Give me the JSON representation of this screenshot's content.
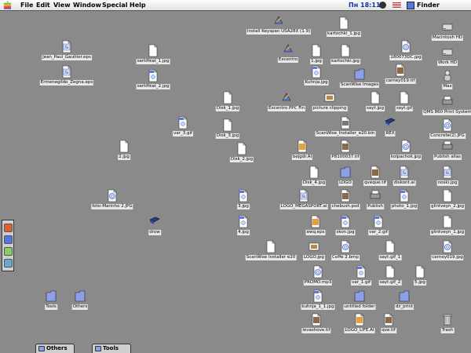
{
  "menubar": {
    "menus": [
      "File",
      "Edit",
      "View",
      "Window",
      "Special",
      "Help"
    ],
    "clock": "Пн 18:11",
    "active_app": "Finder"
  },
  "colors": {
    "desktop": "#8a8a8a",
    "folder": "#8e9fe6",
    "doc": "#ffffff",
    "app": "#5577dd"
  },
  "desktop_icons": [
    {
      "label": "Install Keyspan USA28X (1.9)",
      "type": "app"
    },
    {
      "label": "kartochki_1.jpg",
      "type": "doc"
    },
    {
      "label": "Macintosh HD",
      "type": "disk"
    },
    {
      "label": "Jean_Paul_Gaultier.eps",
      "type": "eps"
    },
    {
      "label": "sertifikat_1.jpg",
      "type": "doc"
    },
    {
      "label": "Excentro",
      "type": "app"
    },
    {
      "label": "1.jpg",
      "type": "doc"
    },
    {
      "label": "kartochki.jpg",
      "type": "doc"
    },
    {
      "label": "180073DC.jpg",
      "type": "qt"
    },
    {
      "label": "Work HD",
      "type": "disk"
    },
    {
      "label": "Ermenegildo_Zegna.eps",
      "type": "eps"
    },
    {
      "label": "sertifikat_2.jpg",
      "type": "jpeg"
    },
    {
      "label": "Kuhnja.jpg",
      "type": "jpeg"
    },
    {
      "label": "ScanWise Images",
      "type": "folder"
    },
    {
      "label": "carney019.tif",
      "type": "photo"
    },
    {
      "label": "Max",
      "type": "user"
    },
    {
      "label": "Disk_1.jpg",
      "type": "doc"
    },
    {
      "label": "Excentro PPC Fin",
      "type": "app"
    },
    {
      "label": "picture clipping",
      "type": "clip"
    },
    {
      "label": "sayt.jpg",
      "type": "doc"
    },
    {
      "label": "sayt.gif",
      "type": "doc"
    },
    {
      "label": "QMS 860 Print System",
      "type": "printer"
    },
    {
      "label": "var_3.gif",
      "type": "gif"
    },
    {
      "label": "Disk_3.jpg",
      "type": "doc"
    },
    {
      "label": "ScanWise_Installer_e20.bin",
      "type": "bin"
    },
    {
      "label": "REX",
      "type": "book"
    },
    {
      "label": "Concrete(2).JPG",
      "type": "qt"
    },
    {
      "label": "2.jpg",
      "type": "doc"
    },
    {
      "label": "Disk_2.jpg",
      "type": "doc"
    },
    {
      "label": "bejgdr.AI",
      "type": "ai"
    },
    {
      "label": "P8100037.tif",
      "type": "photo"
    },
    {
      "label": "kolpachok.jpg",
      "type": "qt"
    },
    {
      "label": "Publish alias",
      "type": "printer"
    },
    {
      "label": "Disk_4.jpg",
      "type": "doc"
    },
    {
      "label": "LOGO",
      "type": "folder"
    },
    {
      "label": "qveque.tif",
      "type": "photo"
    },
    {
      "label": "diskont.ai",
      "type": "eps"
    },
    {
      "label": "noski.jpg",
      "type": "eps"
    },
    {
      "label": "foto-Marinho 2.JPG",
      "type": "qt"
    },
    {
      "label": "3.jpg",
      "type": "jpeg"
    },
    {
      "label": "LOGO_MEGASPORT.ai",
      "type": "eps"
    },
    {
      "label": "chebush.psd",
      "type": "photo"
    },
    {
      "label": "Publish",
      "type": "printer"
    },
    {
      "label": "photo_1.jpg",
      "type": "jpeg"
    },
    {
      "label": "glintveyn_2.jpg",
      "type": "doc"
    },
    {
      "label": "drow",
      "type": "book"
    },
    {
      "label": "4.jpg",
      "type": "jpeg"
    },
    {
      "label": "ewq.eps",
      "type": "ai"
    },
    {
      "label": "skon.jpg",
      "type": "jpeg"
    },
    {
      "label": "var_2.gif",
      "type": "gif"
    },
    {
      "label": "glintveyn_1.jpg",
      "type": "doc"
    },
    {
      "label": "ScanWise Installer e20",
      "type": "doc"
    },
    {
      "label": "LOGO.jpg",
      "type": "clip"
    },
    {
      "label": "Coffe 2.bmp",
      "type": "qt"
    },
    {
      "label": "sayt.gif_1",
      "type": "doc"
    },
    {
      "label": "carney019.jpg",
      "type": "qt"
    },
    {
      "label": "PROMO.mp3",
      "type": "qt"
    },
    {
      "label": "var_1.gif",
      "type": "gif"
    },
    {
      "label": "sayt.gif_2",
      "type": "doc"
    },
    {
      "label": "5.jpg",
      "type": "doc"
    },
    {
      "label": "Tools",
      "type": "folder"
    },
    {
      "label": "Others",
      "type": "folder"
    },
    {
      "label": "kuhnja_1_1.jpg",
      "type": "jpeg"
    },
    {
      "label": "untitled folder",
      "type": "folder"
    },
    {
      "label": "dz_print",
      "type": "folder"
    },
    {
      "label": "levashove.tif",
      "type": "photo"
    },
    {
      "label": "LOGO_LIFE.AI",
      "type": "ai"
    },
    {
      "label": "qve.tif",
      "type": "photo"
    },
    {
      "label": "Trash",
      "type": "trash"
    }
  ],
  "tabs": [
    {
      "label": "Others"
    },
    {
      "label": "Tools"
    }
  ]
}
